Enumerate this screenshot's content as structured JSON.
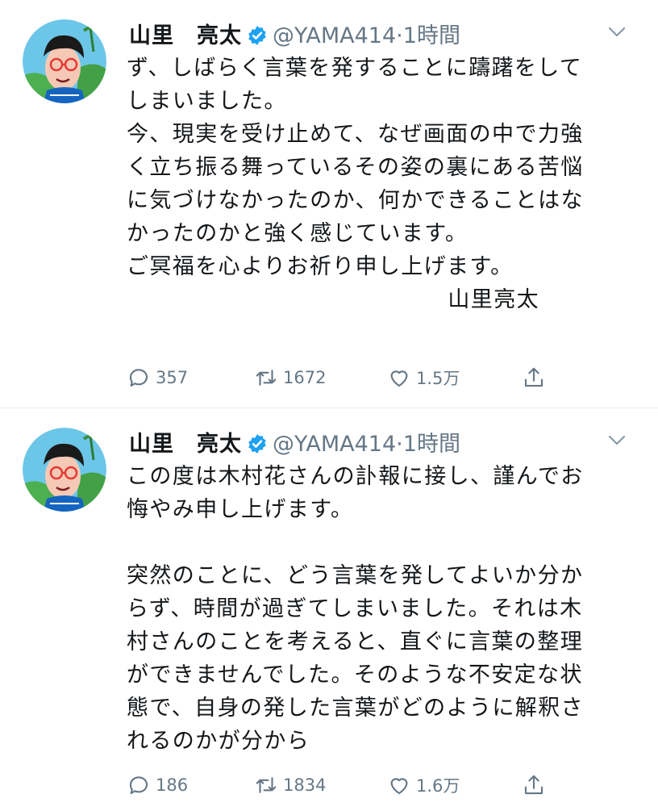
{
  "colors": {
    "text": "#14171a",
    "muted": "#657786",
    "verified": "#1da1f2",
    "divider": "#e6ecf0"
  },
  "tweets": [
    {
      "author": {
        "name": "山里　亮太",
        "handle": "@YAMA414",
        "verified_icon": "verified-badge-icon"
      },
      "separator": "·",
      "time": "1時間",
      "text": "ず、しばらく言葉を発することに躊躇をして\nしまいました。\n今、現実を受け止めて、なぜ画面の中で力強\nく立ち振る舞っているその姿の裏にある苦悩\nに気づけなかったのか、何かできることはな\nかったのかと強く感じています。\nご冥福を心よりお祈り申し上げます。\n",
      "signature": "山里亮太",
      "stats": {
        "replies": "357",
        "retweets": "1672",
        "likes": "1.5万"
      }
    },
    {
      "author": {
        "name": "山里　亮太",
        "handle": "@YAMA414",
        "verified_icon": "verified-badge-icon"
      },
      "separator": "·",
      "time": "1時間",
      "text": "この度は木村花さんの訃報に接し、謹んでお\n悔やみ申し上げます。\n\n突然のことに、どう言葉を発してよいか分か\nらず、時間が過ぎてしまいました。それは木\n村さんのことを考えると、直ぐに言葉の整理\nができませんでした。そのような不安定な状\n態で、自身の発した言葉がどのように解釈さ\nれるのかが分から",
      "stats": {
        "replies": "186",
        "retweets": "1834",
        "likes": "1.6万"
      }
    }
  ]
}
